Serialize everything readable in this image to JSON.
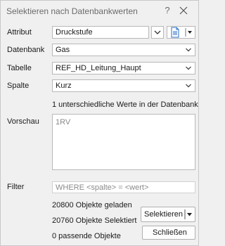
{
  "window": {
    "title": "Selektieren nach Datenbankwerten",
    "help": "?"
  },
  "fields": {
    "attribut": {
      "label": "Attribut",
      "value": "Druckstufe"
    },
    "datenbank": {
      "label": "Datenbank",
      "value": "Gas"
    },
    "tabelle": {
      "label": "Tabelle",
      "value": "REF_HD_Leitung_Haupt"
    },
    "spalte": {
      "label": "Spalte",
      "value": "Kurz"
    }
  },
  "distinct_info": "1 unterschiedliche Werte in der Datenbank",
  "preview": {
    "label": "Vorschau",
    "items": [
      "1RV"
    ]
  },
  "filter": {
    "label": "Filter",
    "placeholder": "WHERE <spalte> = <wert>"
  },
  "status": {
    "loaded": "20800 Objekte geladen",
    "selected": "20760 Objekte Selektiert",
    "matching": "0 passende Objekte"
  },
  "buttons": {
    "select": "Selektieren",
    "close": "Schließen"
  },
  "icons": [
    "close-icon",
    "chevron-down-icon",
    "document-icon",
    "dropdown-arrow-icon"
  ]
}
